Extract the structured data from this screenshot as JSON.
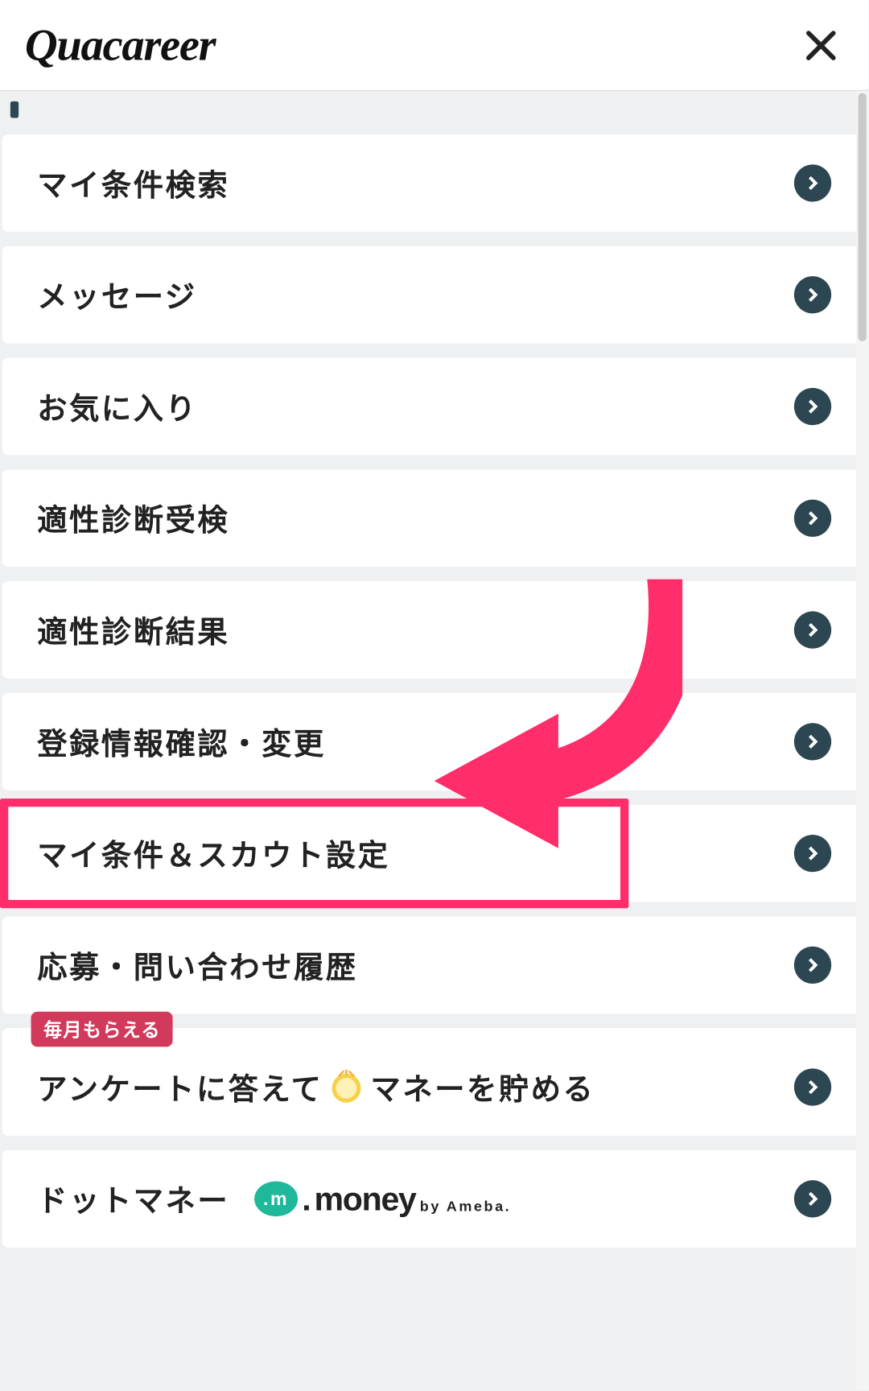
{
  "header": {
    "logo": "Quacareer"
  },
  "menu": {
    "items": [
      {
        "id": "my-search",
        "label": "マイ条件検索"
      },
      {
        "id": "messages",
        "label": "メッセージ"
      },
      {
        "id": "favorites",
        "label": "お気に入り"
      },
      {
        "id": "aptitude-test",
        "label": "適性診断受検"
      },
      {
        "id": "aptitude-result",
        "label": "適性診断結果"
      },
      {
        "id": "registration-info",
        "label": "登録情報確認・変更"
      },
      {
        "id": "scout-settings",
        "label": "マイ条件＆スカウト設定"
      },
      {
        "id": "application-history",
        "label": "応募・問い合わせ履歴"
      }
    ],
    "survey": {
      "badge": "毎月もらえる",
      "prefix": "アンケートに答えて",
      "suffix": "マネーを貯める"
    },
    "dotmoney": {
      "label": "ドットマネー",
      "brand_dot": ".",
      "brand_name": "money",
      "brand_by": "by Ameba."
    }
  },
  "annotation": {
    "highlight_target": "scout-settings"
  }
}
